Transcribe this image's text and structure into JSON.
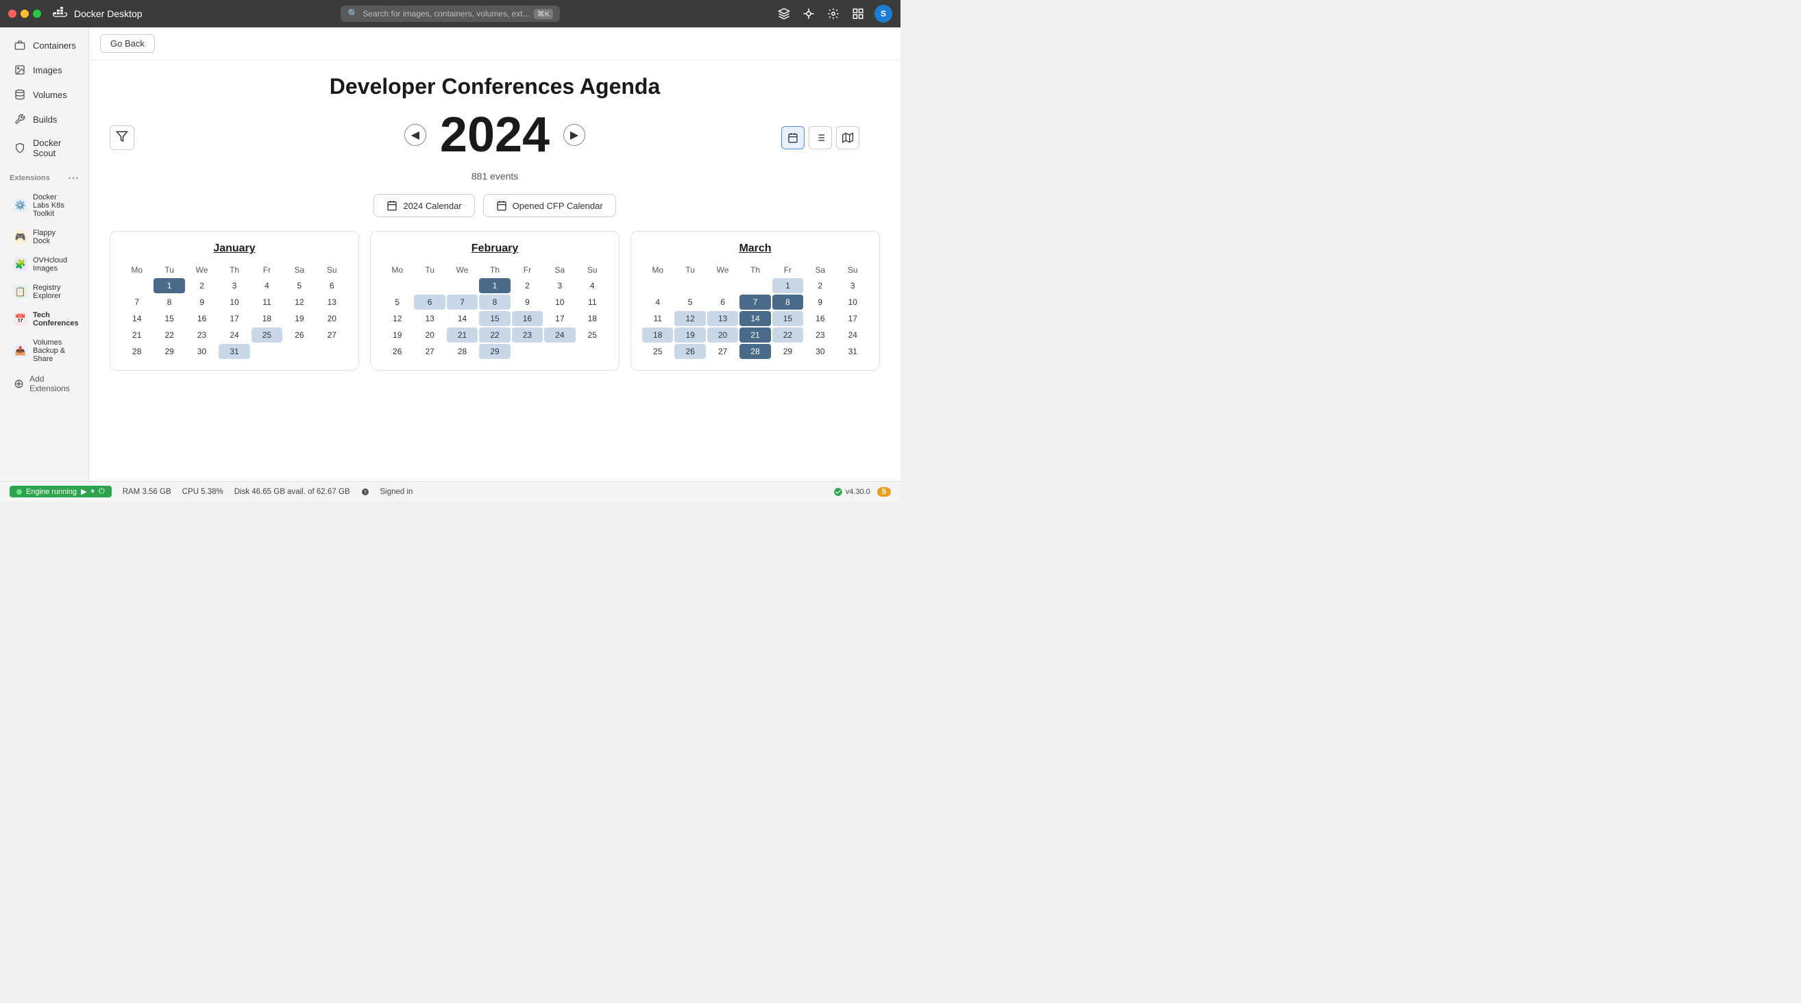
{
  "titlebar": {
    "app_name": "Docker Desktop",
    "search_placeholder": "Search for images, containers, volumes, ext...",
    "kbd_shortcut": "⌘K",
    "user_initial": "S"
  },
  "sidebar": {
    "nav_items": [
      {
        "id": "containers",
        "label": "Containers",
        "icon": "📦"
      },
      {
        "id": "images",
        "label": "Images",
        "icon": "🖼"
      },
      {
        "id": "volumes",
        "label": "Volumes",
        "icon": "💾"
      },
      {
        "id": "builds",
        "label": "Builds",
        "icon": "🔧"
      },
      {
        "id": "docker-scout",
        "label": "Docker Scout",
        "icon": "🛡"
      }
    ],
    "extensions_label": "Extensions",
    "extensions": [
      {
        "id": "k8s",
        "label": "Docker Labs K8s Toolkit",
        "icon": "⚙️",
        "color": "#4a90e2"
      },
      {
        "id": "flappy",
        "label": "Flappy Dock",
        "icon": "🎮",
        "color": "#e8a020"
      },
      {
        "id": "ovh",
        "label": "OVHcloud Images",
        "icon": "🧩",
        "color": "#5b3fb5"
      },
      {
        "id": "registry",
        "label": "Registry Explorer",
        "icon": "📋",
        "color": "#2da44e"
      },
      {
        "id": "tech-conf",
        "label": "Tech Conferences",
        "icon": "📅",
        "color": "#e84040"
      },
      {
        "id": "volumes-backup",
        "label": "Volumes Backup & Share",
        "icon": "📤",
        "color": "#4a90e2"
      }
    ],
    "add_extensions_label": "Add Extensions"
  },
  "main": {
    "go_back_label": "Go Back",
    "page_title": "Developer Conferences Agenda",
    "year": "2024",
    "events_count": "881 events",
    "cal_button_label": "2024 Calendar",
    "cfp_button_label": "Opened CFP Calendar",
    "filter_icon": "⊳",
    "view_buttons": [
      "📅",
      "☰",
      "🗺"
    ],
    "months": [
      {
        "name": "January",
        "days_before": 0,
        "total_days": 31,
        "events": [
          1,
          25,
          31
        ],
        "dark_events": [
          1
        ]
      },
      {
        "name": "February",
        "days_before": 3,
        "total_days": 29,
        "events": [
          1,
          6,
          7,
          8,
          15,
          16,
          21,
          22,
          23,
          24,
          29
        ],
        "dark_events": [
          1
        ]
      },
      {
        "name": "March",
        "days_before": 4,
        "total_days": 31,
        "events": [
          1,
          7,
          8,
          12,
          13,
          14,
          15,
          18,
          19,
          20,
          21,
          22,
          26,
          28
        ],
        "dark_events": [
          7,
          8,
          14,
          21,
          28
        ]
      }
    ]
  },
  "statusbar": {
    "engine_label": "Engine running",
    "ram": "RAM 3.56 GB",
    "cpu": "CPU 5.38%",
    "disk": "Disk 46.65 GB avail. of 62.67 GB",
    "signed_in": "Signed in",
    "version": "v4.30.0",
    "notifications": "5"
  }
}
